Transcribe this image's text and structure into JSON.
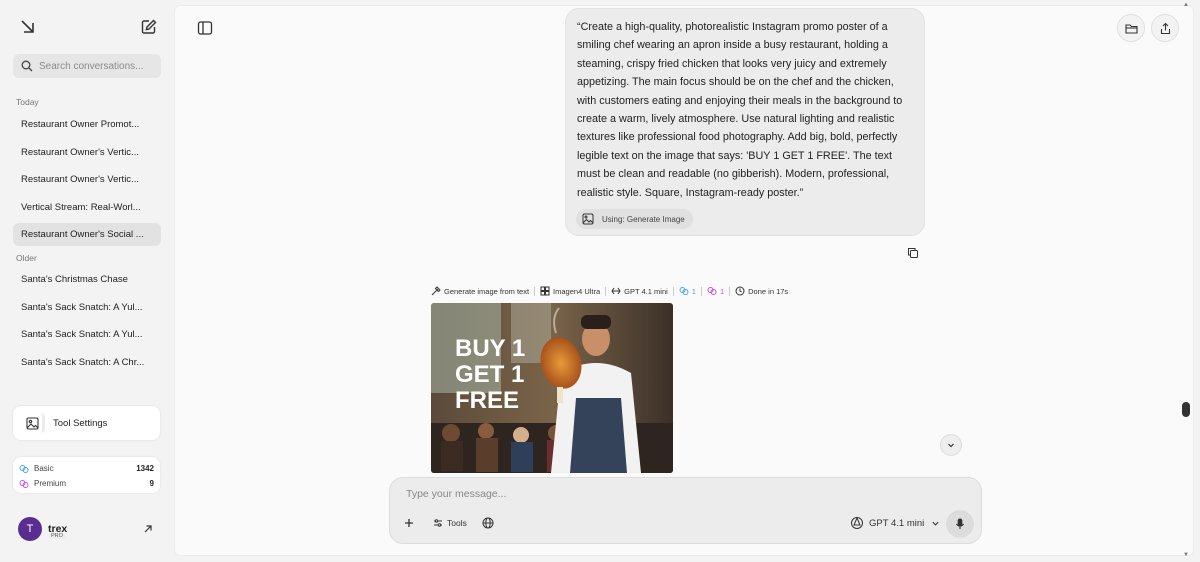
{
  "sidebar": {
    "search_placeholder": "Search conversations...",
    "section_today": "Today",
    "today_items": [
      {
        "label": "Restaurant Owner Promot..."
      },
      {
        "label": "Restaurant Owner's Vertic..."
      },
      {
        "label": "Restaurant Owner's Vertic..."
      },
      {
        "label": "Vertical Stream: Real-Worl..."
      },
      {
        "label": "Restaurant Owner's Social ..."
      }
    ],
    "section_older": "Older",
    "older_items": [
      {
        "label": "Santa's Christmas Chase"
      },
      {
        "label": "Santa's Sack Snatch: A Yul..."
      },
      {
        "label": "Santa's Sack Snatch: A Yul..."
      },
      {
        "label": "Santa's Sack Snatch: A Chr..."
      }
    ],
    "tool_settings_label": "Tool Settings",
    "usage": {
      "basic_label": "Basic",
      "basic_value": "1342",
      "premium_label": "Premium",
      "premium_value": "9"
    },
    "user": {
      "initial": "T",
      "name": "trex",
      "plan": "PRO"
    }
  },
  "conversation": {
    "prompt": "“Create a high-quality, photorealistic Instagram promo poster of a smiling chef wearing an apron inside a busy restaurant, holding a steaming, crispy fried chicken that looks very juicy and extremely appetizing. The main focus should be on the chef and the chicken, with customers eating and enjoying their meals in the background to create a warm, lively atmosphere. Use natural lighting and realistic textures like professional food photography. Add big, bold, perfectly legible text on the image that says: 'BUY 1 GET 1 FREE'. The text must be clean and readable (no gibberish). Modern, professional, realistic style. Square, Instagram-ready poster.”",
    "using_label": "Using: Generate Image",
    "meta": {
      "action": "Generate image from text",
      "engine": "Imagen4 Ultra",
      "model": "GPT 4.1 mini",
      "basic_count": "1",
      "premium_count": "1",
      "status": "Done in 17s"
    },
    "image_text": [
      "BUY 1",
      "GET 1",
      "FREE"
    ]
  },
  "composer": {
    "placeholder": "Type your message...",
    "tools_label": "Tools",
    "model_label": "GPT 4.1 mini"
  },
  "colors": {
    "accent_basic": "#4aa3df",
    "accent_premium": "#c44fd6",
    "avatar_bg": "#5a2d91"
  }
}
